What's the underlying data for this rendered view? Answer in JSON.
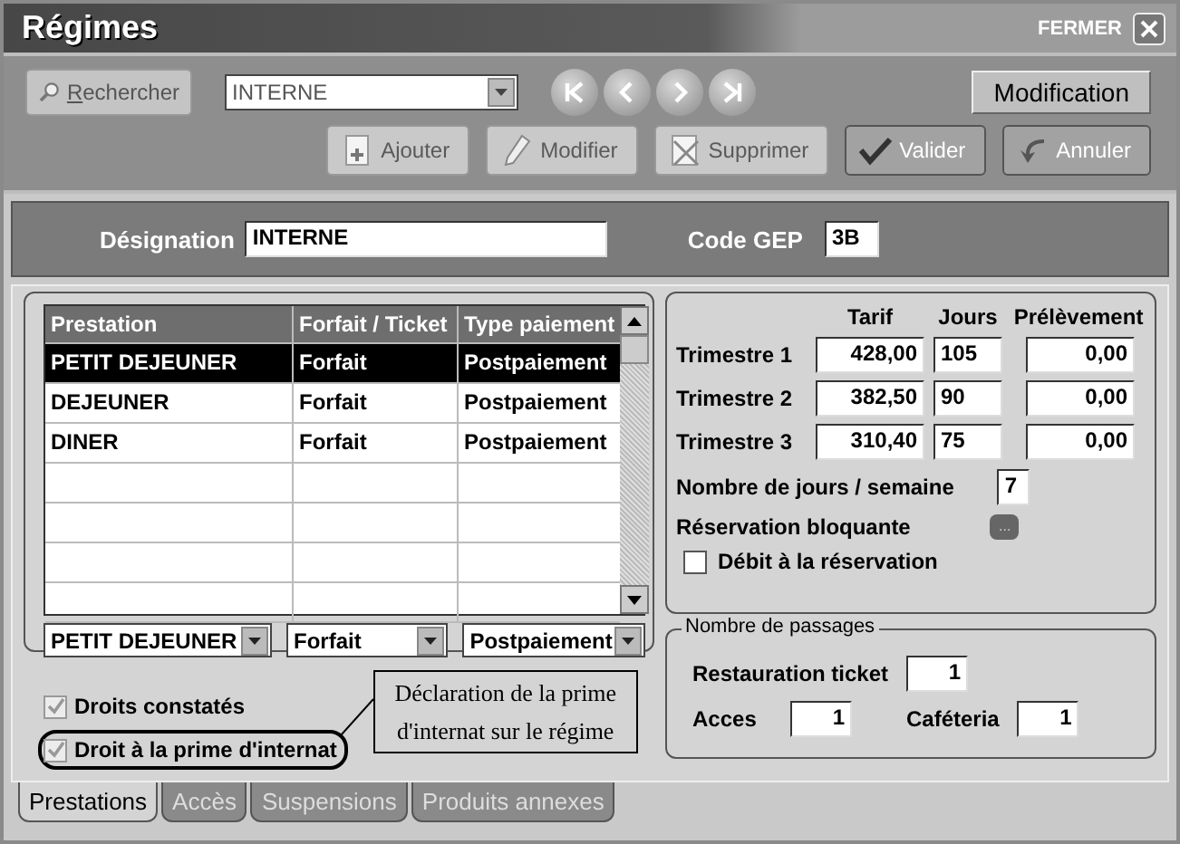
{
  "window": {
    "title": "Régimes",
    "close_label": "FERMER"
  },
  "toolbar": {
    "search_button": {
      "label": "Rechercher"
    },
    "record_combo": {
      "value": "INTERNE"
    },
    "nav_buttons": [
      {
        "kind": "first"
      },
      {
        "kind": "previous"
      },
      {
        "kind": "next"
      },
      {
        "kind": "last"
      }
    ],
    "mode": "Modification",
    "actions": [
      {
        "kind": "add",
        "label": "Ajouter",
        "disabled": true
      },
      {
        "kind": "edit",
        "label": "Modifier",
        "disabled": true
      },
      {
        "kind": "delete",
        "label": "Supprimer",
        "disabled": true
      },
      {
        "kind": "validate",
        "label": "Valider",
        "disabled": false
      },
      {
        "kind": "cancel",
        "label": "Annuler",
        "disabled": false
      }
    ]
  },
  "header": {
    "designation_label": "Désignation",
    "designation_value": "INTERNE",
    "code_label": "Code GEP",
    "code_value": "3B"
  },
  "table": {
    "columns": [
      "Prestation",
      "Forfait / Ticket",
      "Type paiement"
    ],
    "rows": [
      {
        "cells": [
          "PETIT DEJEUNER",
          "Forfait",
          "Postpaiement"
        ],
        "selected": true
      },
      {
        "cells": [
          "DEJEUNER",
          "Forfait",
          "Postpaiement"
        ],
        "selected": false
      },
      {
        "cells": [
          "DINER",
          "Forfait",
          "Postpaiement"
        ],
        "selected": false
      }
    ],
    "editors": [
      "PETIT DEJEUNER",
      "Forfait",
      "Postpaiement"
    ]
  },
  "checkboxes": [
    {
      "label": "Droits constatés",
      "checked": true,
      "disabled": true,
      "highlighted": false
    },
    {
      "label": "Droit à la prime d'internat",
      "checked": true,
      "disabled": true,
      "highlighted": true
    }
  ],
  "callout": "Déclaration de la prime d'internat sur le régime",
  "tarifs": {
    "columns": [
      "Tarif",
      "Jours",
      "Prélèvement"
    ],
    "rows": [
      {
        "label": "Trimestre 1",
        "tarif": "428,00",
        "jours": "105",
        "prelevement": "0,00"
      },
      {
        "label": "Trimestre 2",
        "tarif": "382,50",
        "jours": "90",
        "prelevement": "0,00"
      },
      {
        "label": "Trimestre 3",
        "tarif": "310,40",
        "jours": "75",
        "prelevement": "0,00"
      }
    ],
    "days_label": "Nombre de jours / semaine",
    "days_value": "7",
    "blocking_label": "Réservation bloquante",
    "blocking_button": "...",
    "debit": {
      "label": "Débit à la réservation",
      "checked": false
    }
  },
  "passages": {
    "legend": "Nombre de passages",
    "ticket_label": "Restauration ticket",
    "ticket_value": "1",
    "acces_label": "Acces",
    "acces_value": "1",
    "cafeteria_label": "Caféteria",
    "cafeteria_value": "1"
  },
  "tabs": [
    {
      "label": "Prestations",
      "selected": true
    },
    {
      "label": "Accès",
      "selected": false
    },
    {
      "label": "Suspensions",
      "selected": false
    },
    {
      "label": "Produits annexes",
      "selected": false
    }
  ]
}
